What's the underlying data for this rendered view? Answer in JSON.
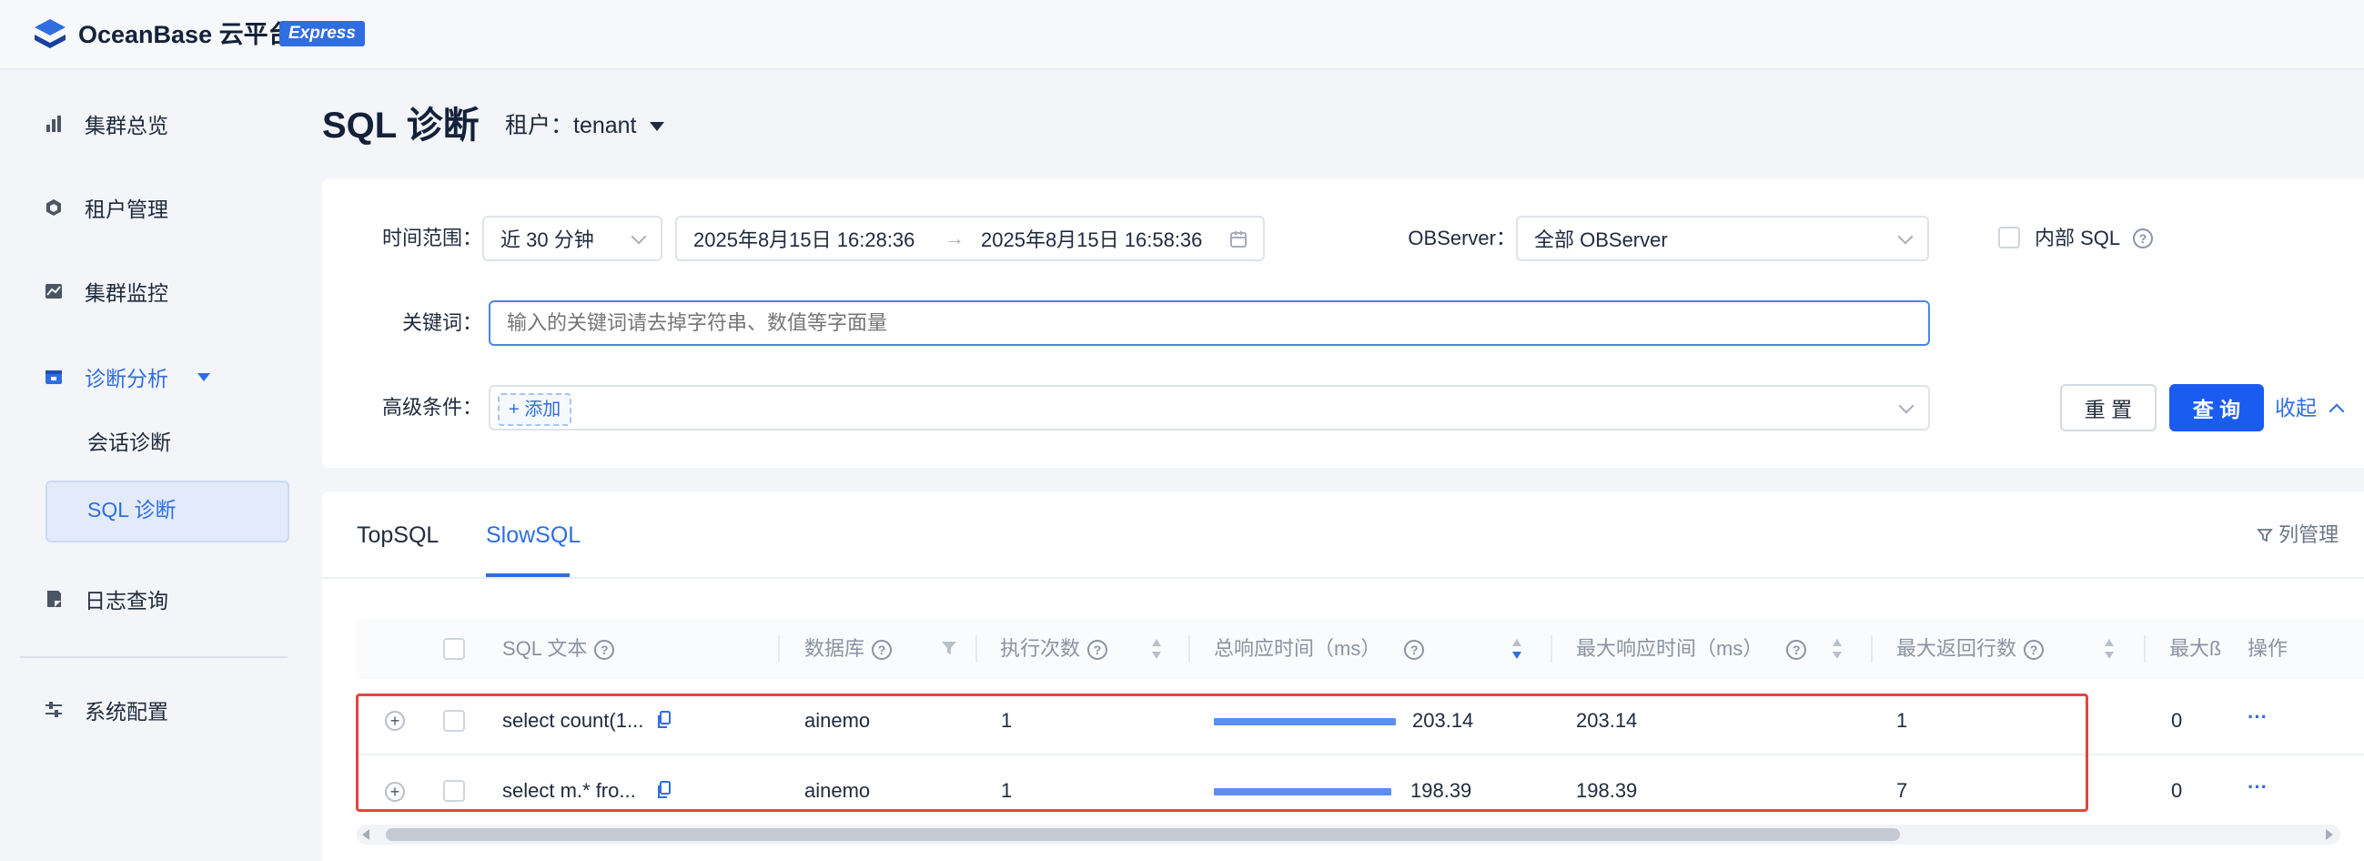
{
  "header": {
    "brand": "OceanBase 云平台",
    "badge": "Express"
  },
  "sidebar": {
    "items": [
      {
        "label": "集群总览",
        "icon": "bar-chart-icon"
      },
      {
        "label": "租户管理",
        "icon": "cube-icon"
      },
      {
        "label": "集群监控",
        "icon": "monitor-chart-icon"
      },
      {
        "label": "诊断分析",
        "icon": "diagnosis-icon",
        "active": true
      },
      {
        "label": "日志查询",
        "icon": "log-icon"
      },
      {
        "label": "系统配置",
        "icon": "settings-sliders-icon"
      }
    ],
    "sub_items": [
      {
        "label": "会话诊断"
      },
      {
        "label": "SQL 诊断",
        "active": true
      }
    ]
  },
  "page": {
    "title": "SQL 诊断",
    "tenant_label": "租户：tenant"
  },
  "filters": {
    "time_label": "时间范围：",
    "time_preset": "近 30 分钟",
    "start": "2025年8月15日 16:28:36",
    "end": "2025年8月15日 16:58:36",
    "range_sep": "→",
    "observer_label": "OBServer：",
    "observer_value": "全部 OBServer",
    "internal_sql": "内部 SQL",
    "keyword_label": "关键词：",
    "keyword_placeholder": "输入的关键词请去掉字符串、数值等字面量",
    "advanced_label": "高级条件：",
    "add_label": "+ 添加",
    "reset": "重 置",
    "query": "查 询",
    "collapse": "收起"
  },
  "tabs": [
    {
      "label": "TopSQL"
    },
    {
      "label": "SlowSQL",
      "active": true
    }
  ],
  "column_manage": "列管理",
  "table": {
    "headers": [
      "SQL 文本",
      "数据库",
      "执行次数",
      "总响应时间（ms）",
      "最大响应时间（ms）",
      "最大返回行数",
      "最大ß",
      "操作"
    ],
    "rows": [
      {
        "sql": "select count(1...",
        "db": "ainemo",
        "exec": "1",
        "total": "203.14",
        "total_fraction": 1.0,
        "max": "203.14",
        "rows": "1",
        "extra": "0",
        "op": "···"
      },
      {
        "sql": "select m.* fro...",
        "db": "ainemo",
        "exec": "1",
        "total": "198.39",
        "total_fraction": 0.977,
        "max": "198.39",
        "rows": "7",
        "extra": "0",
        "op": "···"
      }
    ]
  },
  "colors": {
    "accent": "#2f6de1",
    "bar": "#5b8ff0",
    "highlight": "#e0473c"
  }
}
